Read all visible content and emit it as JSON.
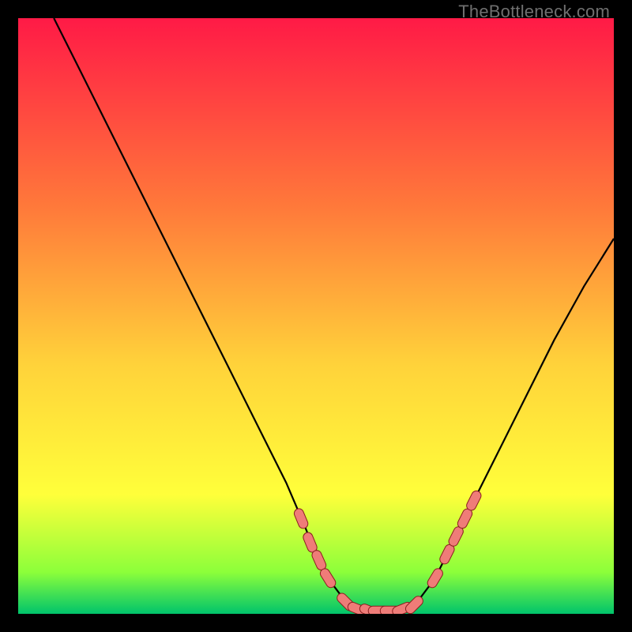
{
  "watermark": "TheBottleneck.com",
  "colors": {
    "bg": "#000000",
    "grad_top": "#ff1a46",
    "grad_mid1": "#ff7a3a",
    "grad_mid2": "#ffd23a",
    "grad_mid3": "#ffff3a",
    "grad_bottom1": "#8cff3a",
    "grad_bottom2": "#00c46b",
    "curve": "#000000",
    "marker_fill": "#ef7c78",
    "marker_stroke": "#8a1f1f"
  },
  "chart_data": {
    "type": "line",
    "title": "",
    "xlabel": "",
    "ylabel": "",
    "xlim": [
      0,
      100
    ],
    "ylim": [
      0,
      100
    ],
    "series": [
      {
        "name": "bottleneck-curve",
        "x": [
          6,
          10,
          15,
          20,
          25,
          30,
          35,
          40,
          45,
          48,
          50,
          52,
          55,
          58,
          60,
          62,
          64,
          67,
          70,
          73,
          76,
          80,
          85,
          90,
          95,
          100
        ],
        "y": [
          100,
          92,
          82,
          72,
          62,
          52,
          42,
          32,
          22,
          15,
          10,
          6,
          2,
          0,
          0,
          0,
          0,
          2,
          6,
          12,
          18,
          26,
          36,
          46,
          55,
          63
        ]
      }
    ],
    "markers": {
      "name": "highlighted-points",
      "x": [
        47.5,
        49,
        50.5,
        52,
        55,
        57,
        59,
        60.5,
        62.5,
        64.5,
        66.5,
        70,
        72,
        73.5,
        75,
        76.5
      ],
      "y": [
        16,
        12,
        9,
        6,
        2,
        0.8,
        0.5,
        0.5,
        0.5,
        0.8,
        1.5,
        6,
        10,
        13,
        16,
        19
      ]
    }
  }
}
